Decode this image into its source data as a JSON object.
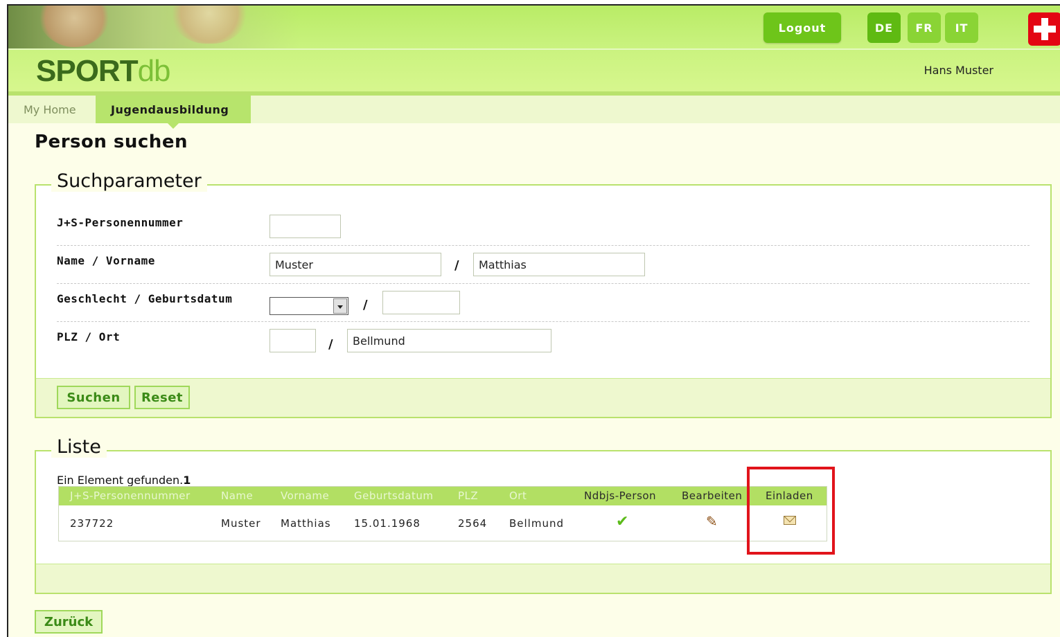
{
  "header": {
    "logo_part1": "SPORT",
    "logo_part2": "db",
    "logout_label": "Logout",
    "languages": [
      "DE",
      "FR",
      "IT"
    ],
    "active_language": "DE",
    "user_name": "Hans Muster"
  },
  "tabs": [
    {
      "label": "My Home",
      "active": false
    },
    {
      "label": "Jugendausbildung",
      "active": true
    }
  ],
  "page_title": "Person suchen",
  "search": {
    "legend": "Suchparameter",
    "rows": [
      {
        "label": "J+S-Personennummer"
      },
      {
        "label": "Name / Vorname"
      },
      {
        "label": "Geschlecht / Geburtsdatum"
      },
      {
        "label": "PLZ / Ort"
      }
    ],
    "fields": {
      "personennummer": "",
      "name": "Muster",
      "vorname": "Matthias",
      "geschlecht": "",
      "geburtsdatum": "",
      "plz": "",
      "ort": "Bellmund"
    },
    "separator": "/",
    "search_label": "Suchen",
    "reset_label": "Reset"
  },
  "list": {
    "legend": "Liste",
    "count_text": "Ein Element gefunden.",
    "count_value": "1",
    "columns": [
      "J+S-Personennummer",
      "Name",
      "Vorname",
      "Geburtsdatum",
      "PLZ",
      "Ort",
      "Ndbjs-Person",
      "Bearbeiten",
      "Einladen"
    ],
    "rows": [
      {
        "personennummer": "237722",
        "name": "Muster",
        "vorname": "Matthias",
        "geburtsdatum": "15.01.1968",
        "plz": "2564",
        "ort": "Bellmund",
        "ndbjs": "check-icon",
        "bearbeiten": "pencil-icon",
        "einladen": "envelope-icon"
      }
    ]
  },
  "back_label": "Zurück",
  "colors": {
    "header_green": "#b9ec66",
    "accent_green": "#6ec51a",
    "highlight_red": "#e1141b"
  }
}
